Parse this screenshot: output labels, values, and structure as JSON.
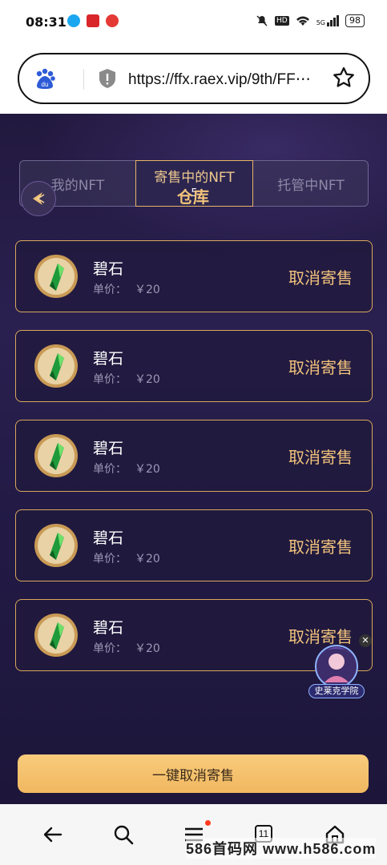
{
  "status_bar": {
    "time": "08:31",
    "hd_badge": "HD",
    "network": "5G",
    "battery": "98"
  },
  "browser": {
    "url": "https://ffx.raex.vip/9th/FF⋯"
  },
  "tabs": [
    {
      "label": "我的NFT"
    },
    {
      "label": "寄售中的NFT",
      "badge": "5"
    },
    {
      "label": "托管中NFT"
    }
  ],
  "page_title": "仓库",
  "items": [
    {
      "name": "碧石",
      "price_label": "单价：",
      "price": "￥20",
      "action": "取消寄售"
    },
    {
      "name": "碧石",
      "price_label": "单价：",
      "price": "￥20",
      "action": "取消寄售"
    },
    {
      "name": "碧石",
      "price_label": "单价：",
      "price": "￥20",
      "action": "取消寄售"
    },
    {
      "name": "碧石",
      "price_label": "单价：",
      "price": "￥20",
      "action": "取消寄售"
    },
    {
      "name": "碧石",
      "price_label": "单价：",
      "price": "￥20",
      "action": "取消寄售"
    }
  ],
  "floating_badge": {
    "label": "史莱克学院"
  },
  "bulk_button": {
    "label": "一键取消寄售"
  },
  "bottom_nav": {
    "tab_count": "11"
  },
  "watermark": "586首码网 www.h586.com",
  "colors": {
    "accent": "#f2c37c",
    "card_border": "#d9a85c",
    "background": "#22193f"
  }
}
